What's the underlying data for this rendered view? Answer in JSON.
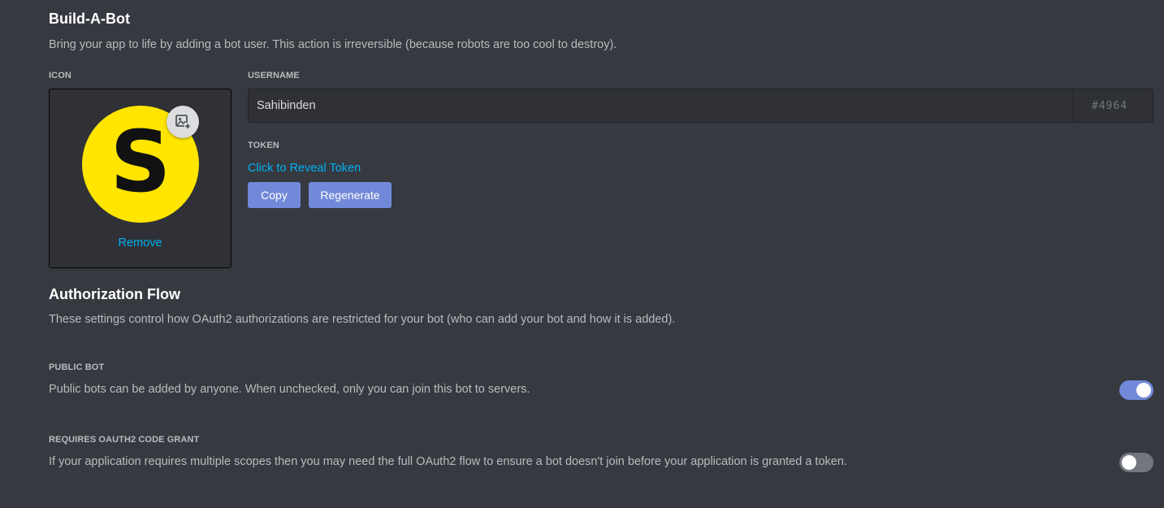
{
  "build_a_bot": {
    "title": "Build-A-Bot",
    "description": "Bring your app to life by adding a bot user. This action is irreversible (because robots are too cool to destroy).",
    "icon_label": "ICON",
    "avatar_letter": "S",
    "avatar_color": "#ffe500",
    "remove_label": "Remove",
    "username_label": "USERNAME",
    "username_value": "Sahibinden",
    "discriminator": "#4964",
    "token_label": "TOKEN",
    "reveal_token_label": "Click to Reveal Token",
    "copy_label": "Copy",
    "regenerate_label": "Regenerate"
  },
  "authorization_flow": {
    "title": "Authorization Flow",
    "description": "These settings control how OAuth2 authorizations are restricted for your bot (who can add your bot and how it is added).",
    "public_bot": {
      "label": "PUBLIC BOT",
      "description": "Public bots can be added by anyone. When unchecked, only you can join this bot to servers.",
      "enabled": true
    },
    "requires_code_grant": {
      "label": "REQUIRES OAUTH2 CODE GRANT",
      "description": "If your application requires multiple scopes then you may need the full OAuth2 flow to ensure a bot doesn't join before your application is granted a token.",
      "enabled": false
    }
  },
  "colors": {
    "background": "#36393f",
    "accent": "#7289da",
    "link": "#00b0f4",
    "toggle_off": "#72767d"
  },
  "icons": {
    "upload": "add-image-icon"
  }
}
